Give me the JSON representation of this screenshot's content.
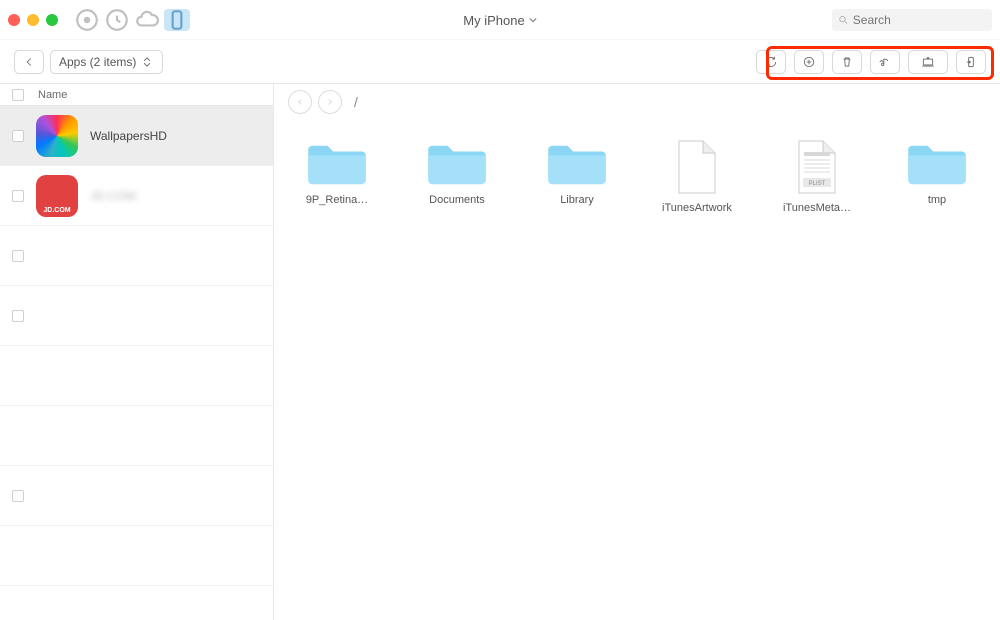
{
  "titlebar": {
    "device_label": "My iPhone",
    "search_placeholder": "Search"
  },
  "toolbar": {
    "crumb_label": "Apps (2 items)"
  },
  "columns": {
    "name": "Name"
  },
  "sidebar": {
    "items": [
      {
        "name": "WallpapersHD",
        "selected": true,
        "icon": "color-wheel"
      },
      {
        "name": "JD.COM",
        "selected": false,
        "icon": "jd-red",
        "blurred": true
      }
    ]
  },
  "content": {
    "path": "/",
    "items": [
      {
        "label": "9P_Retina…",
        "kind": "folder"
      },
      {
        "label": "Documents",
        "kind": "folder"
      },
      {
        "label": "Library",
        "kind": "folder"
      },
      {
        "label": "iTunesArtwork",
        "kind": "file-blank"
      },
      {
        "label": "iTunesMeta…",
        "kind": "file-plist"
      },
      {
        "label": "tmp",
        "kind": "folder"
      }
    ]
  }
}
